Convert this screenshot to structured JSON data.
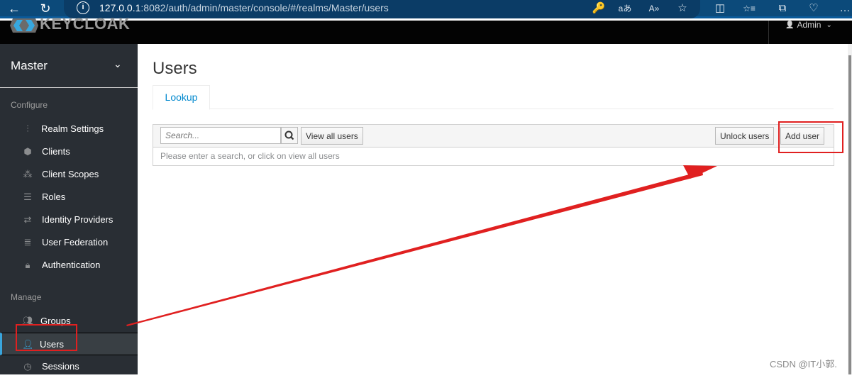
{
  "browser": {
    "url_host": "127.0.0.1",
    "url_rest": ":8082/auth/admin/master/console/#/realms/Master/users",
    "back_icon": "←",
    "refresh_icon": "↻",
    "info_icon": "i",
    "toolbar_icons": [
      "🔑",
      "aあ",
      "A»",
      "☆",
      "◫",
      "☆≡",
      "⧉",
      "♡",
      "…"
    ]
  },
  "header": {
    "logo_text": "KEYCLOAK",
    "user_label": "Admin",
    "user_icon": "👤",
    "chevron": "⌄"
  },
  "sidebar": {
    "realm": "Master",
    "realm_chevron": "⌄",
    "configure_label": "Configure",
    "manage_label": "Manage",
    "configure_items": [
      {
        "label": "Realm Settings",
        "icon": "sliders-icon"
      },
      {
        "label": "Clients",
        "icon": "cube-icon"
      },
      {
        "label": "Client Scopes",
        "icon": "cubes-icon"
      },
      {
        "label": "Roles",
        "icon": "server-icon"
      },
      {
        "label": "Identity Providers",
        "icon": "exchange-icon"
      },
      {
        "label": "User Federation",
        "icon": "database-icon"
      },
      {
        "label": "Authentication",
        "icon": "lock-icon"
      }
    ],
    "manage_items": [
      {
        "label": "Groups",
        "icon": "users-icon"
      },
      {
        "label": "Users",
        "icon": "user-icon",
        "active": true
      },
      {
        "label": "Sessions",
        "icon": "clock-icon"
      }
    ]
  },
  "main": {
    "title": "Users",
    "tabs": [
      {
        "label": "Lookup",
        "active": true
      }
    ],
    "search_placeholder": "Search...",
    "view_all_label": "View all users",
    "unlock_label": "Unlock users",
    "add_user_label": "Add user",
    "hint": "Please enter a search, or click on view all users"
  },
  "watermark": "CSDN @IT小郭.",
  "colors": {
    "accent": "#39a5dc",
    "link": "#0088ce",
    "annotation": "#e02020",
    "sidebar_bg": "#292e34"
  }
}
